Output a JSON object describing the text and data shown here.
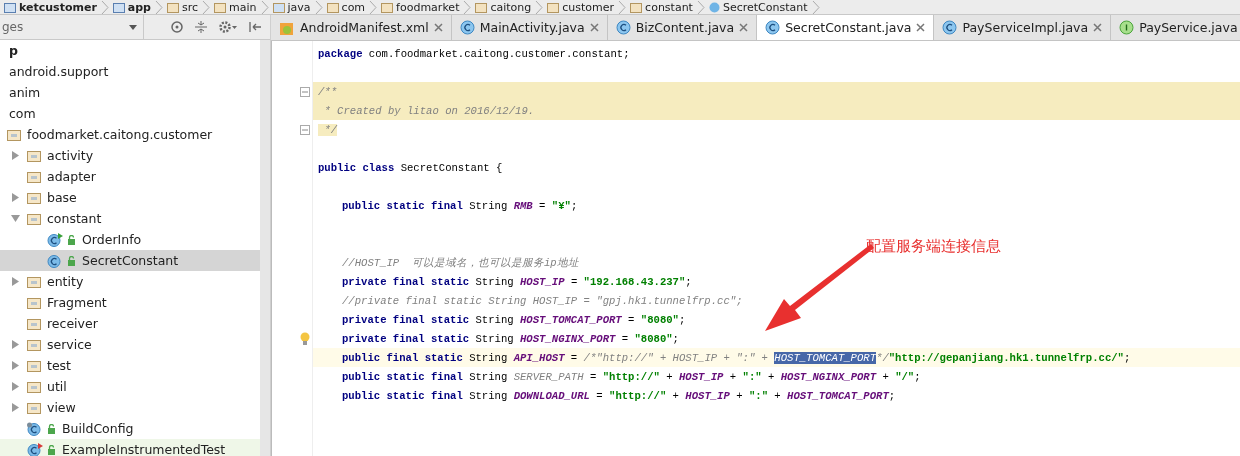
{
  "breadcrumb": [
    {
      "label": "ketcustomer",
      "kind": "module"
    },
    {
      "label": "app",
      "kind": "module"
    },
    {
      "label": "src",
      "kind": "folder"
    },
    {
      "label": "main",
      "kind": "folder"
    },
    {
      "label": "java",
      "kind": "source"
    },
    {
      "label": "com",
      "kind": "folder"
    },
    {
      "label": "foodmarket",
      "kind": "folder"
    },
    {
      "label": "caitong",
      "kind": "folder"
    },
    {
      "label": "customer",
      "kind": "folder"
    },
    {
      "label": "constant",
      "kind": "folder"
    },
    {
      "label": "SecretConstant",
      "kind": "class"
    }
  ],
  "project_panel": {
    "view_selector": "ges",
    "tree": [
      {
        "label": "p",
        "kind": "module",
        "selected": false
      },
      {
        "label": "android.support",
        "kind": "package",
        "selected": false
      },
      {
        "label": "anim",
        "kind": "package",
        "selected": false
      },
      {
        "label": "com",
        "kind": "package",
        "selected": false
      },
      {
        "label": "foodmarket.caitong.customer",
        "kind": "folder",
        "selected": false,
        "children": [
          {
            "label": "activity",
            "kind": "folder",
            "expanded": false,
            "selected": false
          },
          {
            "label": "adapter",
            "kind": "folder",
            "selected": false
          },
          {
            "label": "base",
            "kind": "folder",
            "expanded": false,
            "selected": false
          },
          {
            "label": "constant",
            "kind": "folder",
            "expanded": true,
            "selected": false,
            "children": [
              {
                "label": "OrderInfo",
                "kind": "runnable-class",
                "selected": false
              },
              {
                "label": "SecretConstant",
                "kind": "class",
                "selected": true
              }
            ]
          },
          {
            "label": "entity",
            "kind": "folder",
            "expanded": false,
            "selected": false
          },
          {
            "label": "Fragment",
            "kind": "folder",
            "selected": false
          },
          {
            "label": "receiver",
            "kind": "folder",
            "selected": false
          },
          {
            "label": "service",
            "kind": "folder",
            "expanded": false,
            "selected": false
          },
          {
            "label": "test",
            "kind": "folder",
            "expanded": false,
            "selected": false
          },
          {
            "label": "util",
            "kind": "folder",
            "expanded": false,
            "selected": false
          },
          {
            "label": "view",
            "kind": "folder",
            "expanded": false,
            "selected": false
          },
          {
            "label": "BuildConfig",
            "kind": "generated-class",
            "selected": false
          },
          {
            "label": "ExampleInstrumentedTest",
            "kind": "test-class",
            "selected": false
          }
        ]
      }
    ]
  },
  "tabs": [
    {
      "label": "AndroidManifest.xml",
      "kind": "xml",
      "selected": false
    },
    {
      "label": "MainActivity.java",
      "kind": "class",
      "selected": false
    },
    {
      "label": "BizContent.java",
      "kind": "class",
      "selected": false
    },
    {
      "label": "SecretConstant.java",
      "kind": "class",
      "selected": true
    },
    {
      "label": "PayServiceImpl.java",
      "kind": "class",
      "selected": false
    },
    {
      "label": "PayService.java",
      "kind": "interface",
      "selected": false
    }
  ],
  "editor": {
    "lines": [
      {
        "kind": "plain",
        "tokens": [
          {
            "kind": "kw",
            "text": "package"
          },
          {
            "kind": "plain",
            "text": " com.foodmarket.caitong.customer.constant;"
          }
        ]
      },
      {
        "kind": "blank"
      },
      {
        "kind": "doc",
        "fold_start": true,
        "tokens": [
          {
            "kind": "doc",
            "text": "/**"
          }
        ]
      },
      {
        "kind": "doc",
        "tokens": [
          {
            "kind": "doc",
            "text": " * Created by litao on 2016/12/19."
          }
        ]
      },
      {
        "kind": "plain",
        "fold_end": true,
        "tokens": [
          {
            "kind": "doc",
            "text": " */"
          }
        ]
      },
      {
        "kind": "blank"
      },
      {
        "kind": "plain",
        "tokens": [
          {
            "kind": "kw",
            "text": "public class"
          },
          {
            "kind": "plain",
            "text": " SecretConstant {"
          }
        ]
      },
      {
        "kind": "blank"
      },
      {
        "kind": "plain",
        "indented": true,
        "tokens": [
          {
            "kind": "kw",
            "text": "public static final"
          },
          {
            "kind": "plain",
            "text": " String "
          },
          {
            "kind": "field",
            "text": "RMB"
          },
          {
            "kind": "plain",
            "text": " = "
          },
          {
            "kind": "str",
            "text": "\"¥\""
          },
          {
            "kind": "plain",
            "text": ";"
          }
        ]
      },
      {
        "kind": "blank"
      },
      {
        "kind": "blank"
      },
      {
        "kind": "plain",
        "indented": true,
        "tokens": [
          {
            "kind": "comment",
            "text": "//HOST_IP  可以是域名，也可以是服务ip地址"
          }
        ]
      },
      {
        "kind": "plain",
        "indented": true,
        "tokens": [
          {
            "kind": "kw",
            "text": "private final static"
          },
          {
            "kind": "plain",
            "text": " String "
          },
          {
            "kind": "field",
            "text": "HOST_IP"
          },
          {
            "kind": "plain",
            "text": " = "
          },
          {
            "kind": "str",
            "text": "\"192.168.43.237\""
          },
          {
            "kind": "plain",
            "text": ";"
          }
        ]
      },
      {
        "kind": "plain",
        "indented": true,
        "tokens": [
          {
            "kind": "comment",
            "text": "//private final static String HOST_IP = \"gpj.hk1.tunnelfrp.cc\";"
          }
        ]
      },
      {
        "kind": "plain",
        "indented": true,
        "tokens": [
          {
            "kind": "kw",
            "text": "private final static"
          },
          {
            "kind": "plain",
            "text": " String "
          },
          {
            "kind": "field",
            "text": "HOST_TOMCAT_PORT"
          },
          {
            "kind": "plain",
            "text": " = "
          },
          {
            "kind": "str",
            "text": "\"8080\""
          },
          {
            "kind": "plain",
            "text": ";"
          }
        ]
      },
      {
        "kind": "plain",
        "indented": true,
        "bulb": true,
        "tokens": [
          {
            "kind": "kw",
            "text": "private final static"
          },
          {
            "kind": "plain",
            "text": " String "
          },
          {
            "kind": "field",
            "text": "HOST_NGINX_PORT"
          },
          {
            "kind": "plain",
            "text": " = "
          },
          {
            "kind": "str",
            "text": "\"8080\""
          },
          {
            "kind": "plain",
            "text": ";"
          }
        ]
      },
      {
        "kind": "current",
        "indented": true,
        "tokens": [
          {
            "kind": "kw",
            "text": "public final static"
          },
          {
            "kind": "plain",
            "text": " String "
          },
          {
            "kind": "field",
            "text": "API_HOST"
          },
          {
            "kind": "plain",
            "text": " = "
          },
          {
            "kind": "comment",
            "text": "/*\"http://\" + HOST_IP + \":\" + "
          },
          {
            "kind": "sel",
            "text": "HOST_TOMCAT_PORT"
          },
          {
            "kind": "comment",
            "text": "*/"
          },
          {
            "kind": "str",
            "text": "\"http://gepanjiang.hk1.tunnelfrp.cc/\""
          },
          {
            "kind": "plain",
            "text": ";"
          }
        ]
      },
      {
        "kind": "plain",
        "indented": true,
        "tokens": [
          {
            "kind": "kw",
            "text": "public static final"
          },
          {
            "kind": "plain",
            "text": " String "
          },
          {
            "kind": "unused",
            "text": "SERVER_PATH"
          },
          {
            "kind": "plain",
            "text": " = "
          },
          {
            "kind": "str",
            "text": "\"http://\""
          },
          {
            "kind": "plain",
            "text": " + "
          },
          {
            "kind": "field",
            "text": "HOST_IP"
          },
          {
            "kind": "plain",
            "text": " + "
          },
          {
            "kind": "str",
            "text": "\":\""
          },
          {
            "kind": "plain",
            "text": " + "
          },
          {
            "kind": "field",
            "text": "HOST_NGINX_PORT"
          },
          {
            "kind": "plain",
            "text": " + "
          },
          {
            "kind": "str",
            "text": "\"/\""
          },
          {
            "kind": "plain",
            "text": ";"
          }
        ]
      },
      {
        "kind": "plain",
        "indented": true,
        "tokens": [
          {
            "kind": "kw",
            "text": "public static final"
          },
          {
            "kind": "plain",
            "text": " String "
          },
          {
            "kind": "field",
            "text": "DOWNLOAD_URL"
          },
          {
            "kind": "plain",
            "text": " = "
          },
          {
            "kind": "str",
            "text": "\"http://\""
          },
          {
            "kind": "plain",
            "text": " + "
          },
          {
            "kind": "field",
            "text": "HOST_IP"
          },
          {
            "kind": "plain",
            "text": " + "
          },
          {
            "kind": "str",
            "text": "\":\""
          },
          {
            "kind": "plain",
            "text": " + "
          },
          {
            "kind": "field",
            "text": "HOST_TOMCAT_PORT"
          },
          {
            "kind": "plain",
            "text": ";"
          }
        ]
      }
    ]
  },
  "annotation": {
    "text": "配置服务端连接信息"
  }
}
